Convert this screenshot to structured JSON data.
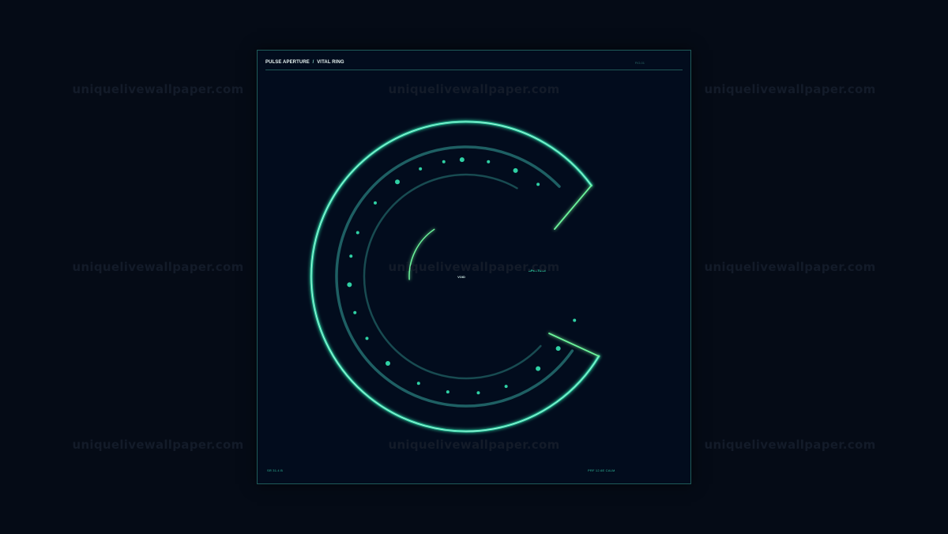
{
  "watermark": "uniquelivewallpaper.com",
  "panel": {
    "title_main": "PULSE APERTURE",
    "title_separator": "/",
    "title_sub": "VITAL RING",
    "header_right": "FIG.01",
    "footer_left": "SR 31.4 B",
    "footer_right": "PRF 12.6E CALM"
  },
  "labels": {
    "center": "VOID",
    "aperture": "APERTURE"
  },
  "colors": {
    "background": "#050b16",
    "panel": "#020c1d",
    "ring_outer": "#2fd4a6",
    "ring_mid": "#1e5f63",
    "ring_inner": "#184b51",
    "accent_green": "#6cf29a",
    "dot": "#2fd0a4"
  },
  "icons": [
    "ring-icon"
  ]
}
